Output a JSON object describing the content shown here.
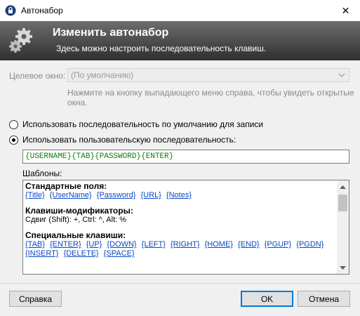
{
  "window": {
    "title": "Автонабор",
    "close_symbol": "✕",
    "app_icon": "lock-icon"
  },
  "banner": {
    "title": "Изменить автонабор",
    "subtitle": "Здесь можно настроить последовательность клавиш.",
    "icon": "gears-icon"
  },
  "target_window": {
    "label": "Целевое окно:",
    "value": "(По умолчанию)",
    "hint": "Нажмите на кнопку выпадающего меню справа, чтобы увидеть открытые окна."
  },
  "options": {
    "default_label": "Использовать последовательность по умолчанию для записи",
    "custom_label": "Использовать пользовательскую последовательность:",
    "selected": "custom"
  },
  "sequence": {
    "value": "{USERNAME}{TAB}{PASSWORD}{ENTER}",
    "color": "#0e7b0e"
  },
  "templates": {
    "label": "Шаблоны:",
    "standard_header": "Стандартные поля:",
    "standard_fields": [
      "{Title}",
      "{UserName}",
      "{Password}",
      "{URL}",
      "{Notes}"
    ],
    "modifiers_header": "Клавиши-модификаторы:",
    "modifiers_text": "Сдвиг (Shift): +, Ctrl: ^, Alt: %",
    "special_header": "Специальные клавиши:",
    "special_keys": [
      "{TAB}",
      "{ENTER}",
      "{UP}",
      "{DOWN}",
      "{LEFT}",
      "{RIGHT}",
      "{HOME}",
      "{END}",
      "{PGUP}",
      "{PGDN}",
      "{INSERT}",
      "{DELETE}",
      "{SPACE}"
    ],
    "link_color": "#0a47c4"
  },
  "buttons": {
    "help": "Справка",
    "ok": "OK",
    "cancel": "Отмена"
  }
}
